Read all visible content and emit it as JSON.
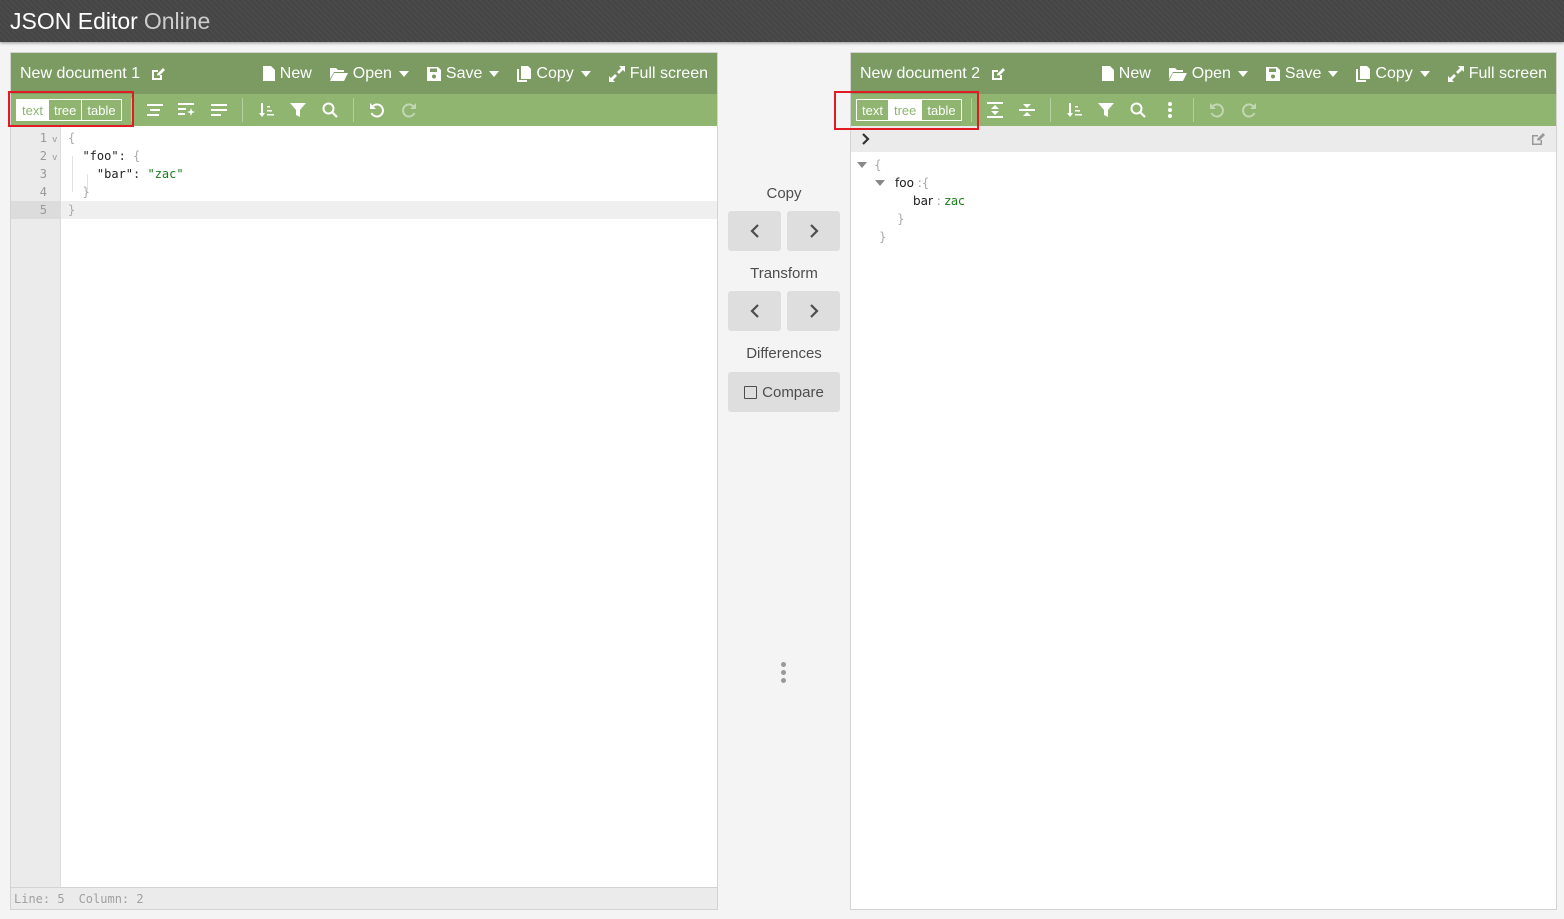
{
  "app": {
    "title_strong": "JSON Editor",
    "title_light": "Online"
  },
  "colors": {
    "menu_bar": "#7b9b63",
    "toolbar": "#8fb571",
    "highlight": "#e01b24",
    "string_value": "#1a7d1a"
  },
  "left_panel": {
    "document_title": "New document 1",
    "menu": {
      "new_label": "New",
      "open_label": "Open",
      "save_label": "Save",
      "copy_label": "Copy",
      "fullscreen_label": "Full screen"
    },
    "modes": [
      {
        "label": "text",
        "active": true
      },
      {
        "label": "tree",
        "active": false
      },
      {
        "label": "table",
        "active": false
      }
    ],
    "toolbar_icons": [
      "format-icon",
      "smart-format-icon",
      "compact-icon",
      "sort-icon",
      "filter-icon",
      "search-icon",
      "undo-icon",
      "redo-icon"
    ],
    "code_lines": [
      {
        "number": "1",
        "fold": "v",
        "text": "{"
      },
      {
        "number": "2",
        "fold": "v",
        "text": "  \"foo\": {"
      },
      {
        "number": "3",
        "fold": "",
        "text": "    \"bar\": \"zac\""
      },
      {
        "number": "4",
        "fold": "",
        "text": "  }"
      },
      {
        "number": "5",
        "fold": "",
        "text": "}"
      }
    ],
    "active_line": 5,
    "status": {
      "line_label": "Line: 5",
      "column_label": "Column: 2"
    }
  },
  "middle": {
    "copy_label": "Copy",
    "transform_label": "Transform",
    "differences_label": "Differences",
    "compare_label": "Compare",
    "compare_checked": false
  },
  "right_panel": {
    "document_title": "New document 2",
    "menu": {
      "new_label": "New",
      "open_label": "Open",
      "save_label": "Save",
      "copy_label": "Copy",
      "fullscreen_label": "Full screen"
    },
    "modes": [
      {
        "label": "text",
        "active": false
      },
      {
        "label": "tree",
        "active": true
      },
      {
        "label": "table",
        "active": false
      }
    ],
    "toolbar_icons": [
      "expand-all-icon",
      "collapse-all-icon",
      "sort-icon",
      "filter-icon",
      "search-icon",
      "more-icon",
      "undo-icon",
      "redo-icon"
    ],
    "tree": {
      "root_open": "{",
      "key": "foo",
      "separator": ":",
      "child_open": "{",
      "child_key": "bar",
      "child_value": "zac",
      "child_close": "}",
      "root_close": "}"
    }
  }
}
